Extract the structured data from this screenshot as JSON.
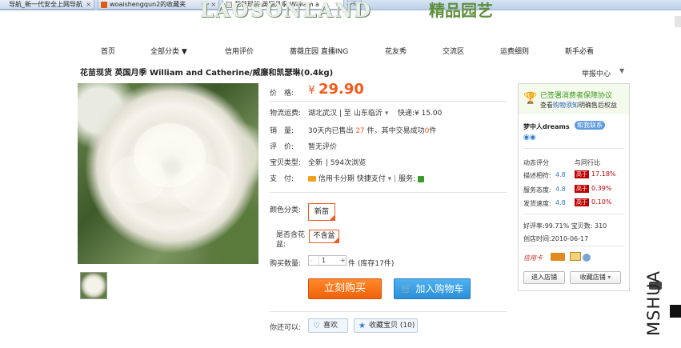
{
  "browser": {
    "tabs": [
      {
        "title": "导航_新一代安全上网导航",
        "active": false
      },
      {
        "title": "woaishengqun2的收藏夹",
        "active": false
      },
      {
        "title": "花苗现货 英国月季 William a",
        "active": true
      }
    ],
    "new_tab": "+"
  },
  "header": {
    "logo_text": "LAOSONLAND",
    "logo_cn": "精品园艺"
  },
  "nav": {
    "items": [
      "首页",
      "全部分类 ▼",
      "信用评价",
      "蔷薇庄园 直播ING",
      "花友秀",
      "交流区",
      "运费细则",
      "新手必看"
    ]
  },
  "product": {
    "title": "花苗现货 英国月季 William and Catherine/威廉和凯瑟琳(0.4kg)",
    "report": "举报中心",
    "price_label": "价　格:",
    "currency": "¥",
    "price": "29.90",
    "shipping_label": "物流运费:",
    "shipping_from": "湖北武汉 | 至",
    "shipping_to": "山东临沂",
    "shipping_fee": "快递:¥ 15.00",
    "sales_label": "销　量:",
    "sales_prefix": "30天内已售出",
    "sales_count": "27",
    "sales_mid": "件，其中交易成功",
    "sales_success": "0",
    "sales_suffix": "件",
    "rating_label": "评　价:",
    "rating_value": "暂无评价",
    "type_label": "宝贝类型:",
    "type_value": "全新",
    "views": "594次浏览",
    "payment_label": "支　付:",
    "payment_installment": "信用卡分期",
    "payment_fast": "快捷支付",
    "service_label": "服务:",
    "color_label": "颜色分类:",
    "color_option": "新苗",
    "pot_label": "是否含花盆:",
    "pot_option": "不含盆",
    "qty_label": "购买数量:",
    "qty_minus": "-",
    "qty_value": "1",
    "qty_plus": "+",
    "qty_stock": "件 (库存17件)",
    "buy_now": "立刻购买",
    "add_cart": "加入购物车",
    "you_can": "你还可以:",
    "like": "喜欢",
    "favorite": "收藏宝贝 (10)"
  },
  "seller": {
    "guarantee": "已签署消费者保障协议",
    "guarantee_sub_pre": "查看",
    "guarantee_sub_link": "购物须知",
    "guarantee_sub_post": "明确售后权益",
    "shop_owner": "梦中人dreams",
    "contact": "和我联系",
    "dynamic_score": "动态评分",
    "compare": "与同行比",
    "scores": [
      {
        "name": "描述相符:",
        "score": "4.8",
        "tag": "高于",
        "pct": "17.18%"
      },
      {
        "name": "服务态度:",
        "score": "4.8",
        "tag": "高于",
        "pct": "0.39%"
      },
      {
        "name": "发货速度:",
        "score": "4.8",
        "tag": "高于",
        "pct": "0.10%"
      }
    ],
    "good_rate": "好评率:99.71% 宝贝数: 310",
    "created": "创店时间:2010-06-17",
    "enter_store": "进入店铺",
    "fav_store": "收藏店铺"
  },
  "watermark": "MSHUA"
}
